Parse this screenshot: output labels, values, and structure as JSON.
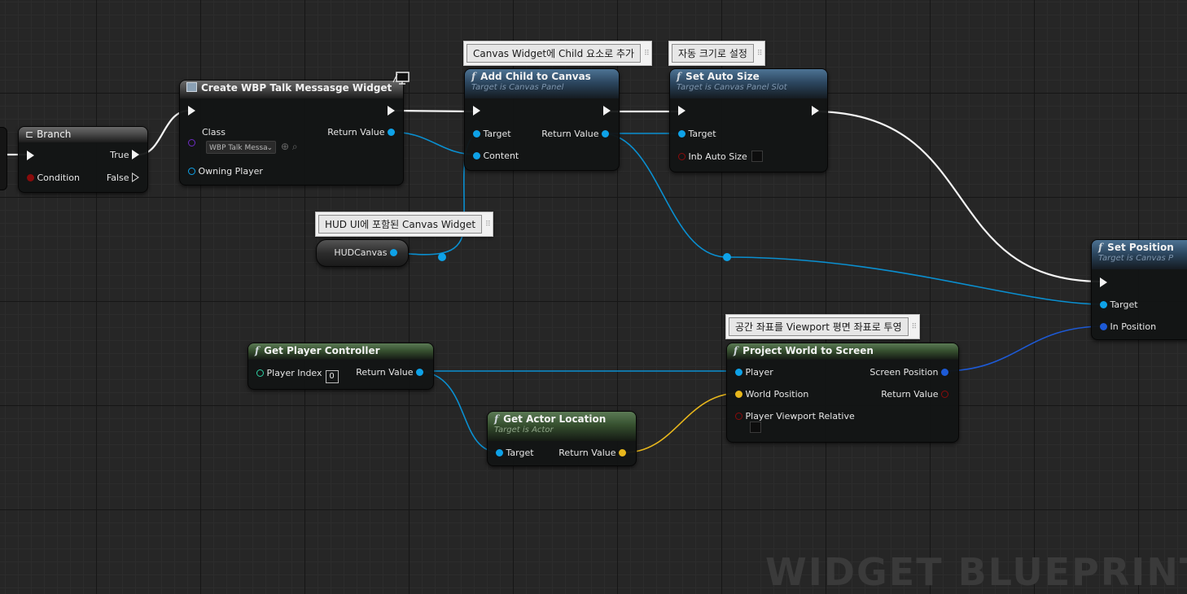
{
  "colors": {
    "exec": "#f2f2f2",
    "object": "#0ea2e8",
    "vector": "#e8b71c",
    "vector2d": "#1d5ad6",
    "bool": "#8a0b0b",
    "int": "#2fd1a4",
    "class": "#6d2cc4"
  },
  "nodes": {
    "branch": {
      "title": "Branch",
      "icon": "branch-icon",
      "pins": {
        "condition": "Condition",
        "true": "True",
        "false": "False"
      }
    },
    "create_widget": {
      "title": "Create WBP Talk Messasge Widget",
      "icon": "widget-icon",
      "corner_icon": "monitor-icon",
      "pins": {
        "class": "Class",
        "class_value": "WBP Talk Messa",
        "owning_player": "Owning Player",
        "return_value": "Return Value"
      }
    },
    "add_child": {
      "title": "Add Child to Canvas",
      "subtitle": "Target is Canvas Panel",
      "pins": {
        "target": "Target",
        "content": "Content",
        "return_value": "Return Value"
      }
    },
    "set_auto_size": {
      "title": "Set Auto Size",
      "subtitle": "Target is Canvas Panel Slot",
      "pins": {
        "target": "Target",
        "inb_auto_size": "Inb Auto Size"
      }
    },
    "hud_canvas": {
      "title": "HUDCanvas"
    },
    "set_position": {
      "title": "Set Position",
      "subtitle": "Target is Canvas P",
      "pins": {
        "target": "Target",
        "in_position": "In Position"
      }
    },
    "get_player_controller": {
      "title": "Get Player Controller",
      "pins": {
        "player_index": "Player Index",
        "player_index_value": "0",
        "return_value": "Return Value"
      }
    },
    "get_actor_location": {
      "title": "Get Actor Location",
      "subtitle": "Target is Actor",
      "pins": {
        "target": "Target",
        "return_value": "Return Value"
      }
    },
    "project_world": {
      "title": "Project World to Screen",
      "pins": {
        "player": "Player",
        "world_position": "World Position",
        "viewport_relative": "Player Viewport Relative",
        "screen_position": "Screen Position",
        "return_value": "Return Value"
      }
    }
  },
  "comments": {
    "add_child": "Canvas Widget에 Child 요소로 추가",
    "auto_size": "자동 크기로 설정",
    "hud_canvas": "HUD UI에 포함된 Canvas Widget",
    "project": "공간 좌표를 Viewport 평면 좌표로 투영"
  },
  "function_glyph": "f",
  "watermark": "WIDGET BLUEPRINT"
}
